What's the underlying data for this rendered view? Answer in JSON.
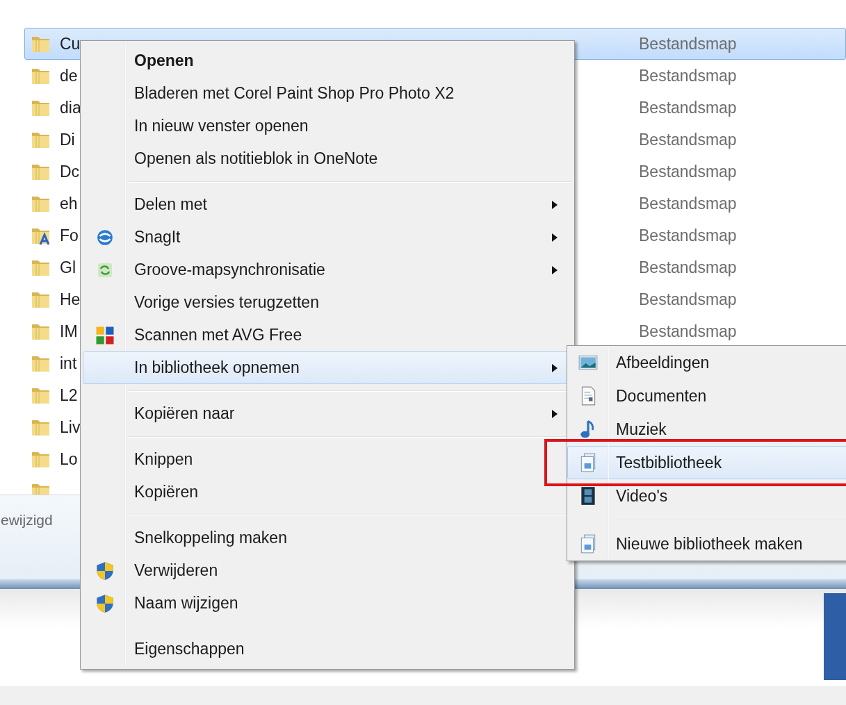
{
  "file_list": {
    "rows": [
      {
        "name": "Cu",
        "type": "Bestandsmap",
        "kind": "folder",
        "selected": true
      },
      {
        "name": "de",
        "type": "Bestandsmap",
        "kind": "folder",
        "selected": false
      },
      {
        "name": "dia",
        "type": "Bestandsmap",
        "kind": "folder",
        "selected": false
      },
      {
        "name": "Di",
        "type": "Bestandsmap",
        "kind": "folder",
        "selected": false
      },
      {
        "name": "Dc",
        "type": "Bestandsmap",
        "kind": "folder",
        "selected": false
      },
      {
        "name": "eh",
        "type": "Bestandsmap",
        "kind": "folder",
        "selected": false
      },
      {
        "name": "Fo",
        "type": "Bestandsmap",
        "kind": "font-folder",
        "selected": false
      },
      {
        "name": "Gl",
        "type": "Bestandsmap",
        "kind": "folder",
        "selected": false
      },
      {
        "name": "He",
        "type": "Bestandsmap",
        "kind": "folder",
        "selected": false
      },
      {
        "name": "IM",
        "type": "Bestandsmap",
        "kind": "folder",
        "selected": false
      },
      {
        "name": "int",
        "kind": "folder",
        "selected": false
      },
      {
        "name": "L2",
        "kind": "folder",
        "selected": false
      },
      {
        "name": "Liv",
        "kind": "folder",
        "selected": false
      },
      {
        "name": "Lo",
        "kind": "folder",
        "selected": false
      },
      {
        "kind": "folder",
        "selected": false
      }
    ]
  },
  "details_pane": {
    "text": "ewijzigd"
  },
  "context_menu": {
    "groups": [
      [
        {
          "label": "Openen",
          "kind": "plain",
          "default": true,
          "submenu": false,
          "selected": false
        },
        {
          "label": "Bladeren met Corel Paint Shop Pro Photo X2",
          "kind": "plain",
          "default": false,
          "submenu": false,
          "selected": false
        },
        {
          "label": "In nieuw venster openen",
          "kind": "plain",
          "default": false,
          "submenu": false,
          "selected": false
        },
        {
          "label": "Openen als notitieblok in OneNote",
          "kind": "plain",
          "default": false,
          "submenu": false,
          "selected": false
        }
      ],
      [
        {
          "label": "Delen met",
          "kind": "plain",
          "default": false,
          "submenu": true,
          "selected": false
        },
        {
          "label": "SnagIt",
          "kind": "swirl",
          "default": false,
          "submenu": true,
          "selected": false
        },
        {
          "label": "Groove-mapsynchronisatie",
          "kind": "sync",
          "default": false,
          "submenu": true,
          "selected": false
        },
        {
          "label": "Vorige versies terugzetten",
          "kind": "plain",
          "default": false,
          "submenu": false,
          "selected": false
        },
        {
          "label": "Scannen met AVG Free",
          "kind": "blocks",
          "default": false,
          "submenu": false,
          "selected": false
        },
        {
          "label": "In bibliotheek opnemen",
          "kind": "plain",
          "default": false,
          "submenu": true,
          "selected": true
        }
      ],
      [
        {
          "label": "Kopiëren naar",
          "kind": "plain",
          "default": false,
          "submenu": true,
          "selected": false
        }
      ],
      [
        {
          "label": "Knippen",
          "kind": "plain",
          "default": false,
          "submenu": false,
          "selected": false
        },
        {
          "label": "Kopiëren",
          "kind": "plain",
          "default": false,
          "submenu": false,
          "selected": false
        }
      ],
      [
        {
          "label": "Snelkoppeling maken",
          "kind": "plain",
          "default": false,
          "submenu": false,
          "selected": false
        },
        {
          "label": "Verwijderen",
          "kind": "shield",
          "default": false,
          "submenu": false,
          "selected": false
        },
        {
          "label": "Naam wijzigen",
          "kind": "shield",
          "default": false,
          "submenu": false,
          "selected": false
        }
      ],
      [
        {
          "label": "Eigenschappen",
          "kind": "plain",
          "default": false,
          "submenu": false,
          "selected": false
        }
      ]
    ]
  },
  "submenu": {
    "groups": [
      [
        {
          "label": "Afbeeldingen",
          "kind": "picture",
          "selected": false
        },
        {
          "label": "Documenten",
          "kind": "document",
          "selected": false
        },
        {
          "label": "Muziek",
          "kind": "music",
          "selected": false
        },
        {
          "label": "Testbibliotheek",
          "kind": "library",
          "selected": true
        },
        {
          "label": "Video's",
          "kind": "film",
          "selected": false
        }
      ],
      [
        {
          "label": "Nieuwe bibliotheek maken",
          "kind": "library",
          "selected": false
        }
      ]
    ]
  }
}
